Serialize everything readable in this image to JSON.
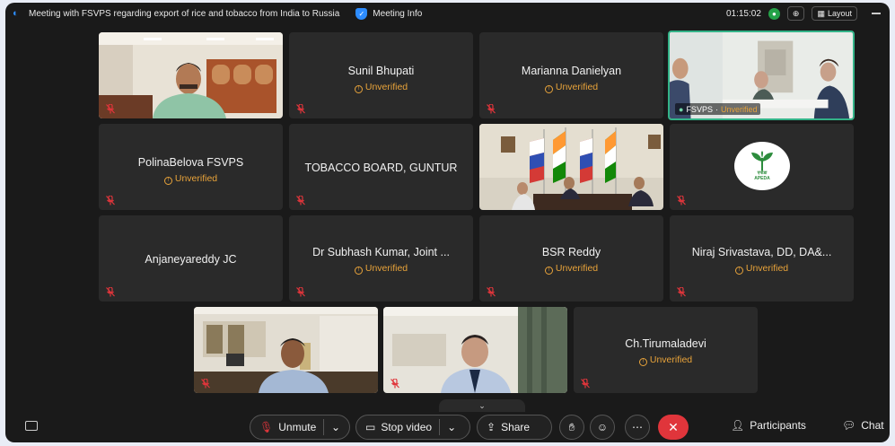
{
  "titlebar": {
    "meeting_title": "Meeting with FSVPS regarding export of rice and tobacco from India to Russia",
    "info_label": "Meeting Info",
    "timer": "01:15:02",
    "layout_label": "Layout"
  },
  "status_unverified": "Unverified",
  "tiles": {
    "sunil": {
      "name": "Sunil Bhupati",
      "status": "Unverified"
    },
    "marianna": {
      "name": "Marianna Danielyan",
      "status": "Unverified"
    },
    "fsvps": {
      "name": "FSVPS",
      "status": "Unverified"
    },
    "polina": {
      "name": "PolinaBelova FSVPS",
      "status": "Unverified"
    },
    "tobacco": {
      "name": "TOBACCO BOARD, GUNTUR"
    },
    "anjaneya": {
      "name": "Anjaneyareddy JC"
    },
    "subhash": {
      "name": "Dr Subhash Kumar, Joint ...",
      "status": "Unverified"
    },
    "bsr": {
      "name": "BSR Reddy",
      "status": "Unverified"
    },
    "niraj": {
      "name": "Niraj Srivastava, DD, DA&...",
      "status": "Unverified"
    },
    "tirumala": {
      "name": "Ch.Tirumaladevi",
      "status": "Unverified"
    },
    "apeda": {
      "logo_text": "APEDA",
      "logo_hindi": "एपीडा"
    }
  },
  "controls": {
    "unmute": "Unmute",
    "stop_video": "Stop video",
    "share": "Share",
    "participants": "Participants",
    "chat": "Chat"
  },
  "colors": {
    "accent": "#2d8cff",
    "unverified": "#e8a33a",
    "end_call": "#e0353b",
    "active_speaker": "#33b388"
  }
}
